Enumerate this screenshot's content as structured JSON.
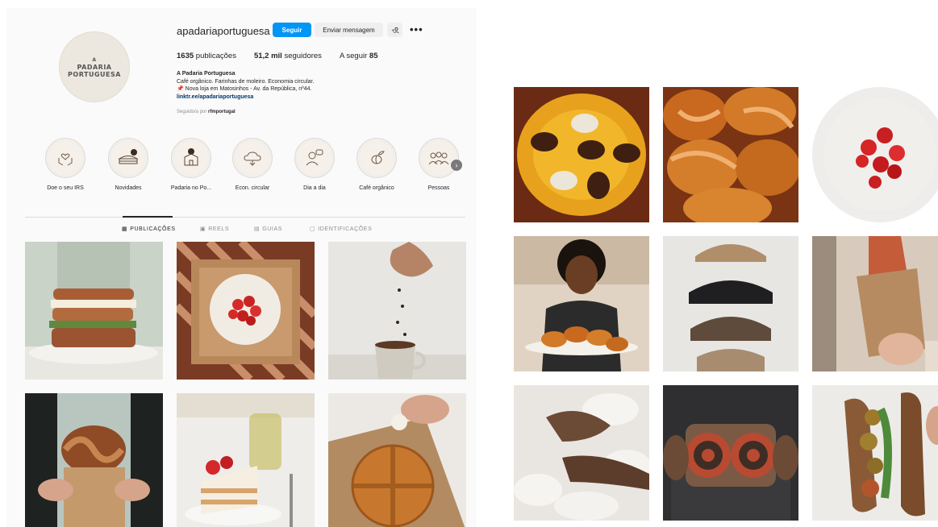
{
  "profile": {
    "avatar_line1": "A",
    "avatar_line2": "PADARIA",
    "avatar_line3": "PORTUGUESA",
    "username": "apadariaportuguesa",
    "follow_label": "Seguir",
    "message_label": "Enviar mensagem",
    "add_label": "+⚇",
    "more_label": "•••",
    "posts_count": "1635",
    "posts_label": " publicações",
    "followers_count": "51,2 mil",
    "followers_label": " seguidores",
    "following_label": "A seguir ",
    "following_count": "85",
    "bio_name": "A Padaria Portuguesa",
    "bio_line1": "Café orgânico. Farinhas de moleiro. Economia circular.",
    "bio_line2": "📌 Nova loja em Matosinhos - Av. da República, nº44.",
    "bio_link": "linktr.ee/apadariaportuguesa",
    "followed_by_prefix": "Seguido/a por ",
    "followed_by_user": "rfmportugal"
  },
  "highlights": [
    {
      "label": "Doe o seu IRS",
      "icon": "heart-hands-icon"
    },
    {
      "label": "Novidades",
      "icon": "sandwich-icon"
    },
    {
      "label": "Padaria no Po...",
      "icon": "store-icon"
    },
    {
      "label": "Econ. circular",
      "icon": "recycle-cloud-icon"
    },
    {
      "label": "Dia a dia",
      "icon": "person-chat-icon"
    },
    {
      "label": "Café orgânico",
      "icon": "coffee-beans-icon"
    },
    {
      "label": "Pessoas",
      "icon": "people-icon"
    }
  ],
  "tabs": {
    "posts": "PUBLICAÇÕES",
    "reels": "REELS",
    "guides": "GUIAS",
    "tagged": "IDENTIFICAÇÕES"
  },
  "colors": {
    "accent": "#0095f6",
    "panel_bg": "#fafafa",
    "avatar_bg": "#ede8df"
  },
  "left_posts": [
    "sandwich",
    "strawberry-cake-box",
    "coffee-beans-pour",
    "twisted-bread",
    "strawberry-cake-slice",
    "round-bread"
  ],
  "right_posts": [
    "egg-nest-pastry",
    "glazed-buns",
    "strawberry-tart",
    "baker-with-buns",
    "bread-slices",
    "bread-in-paper-bag",
    "hands-kneading-dough",
    "swirl-loaf",
    "falafel-sandwich"
  ]
}
